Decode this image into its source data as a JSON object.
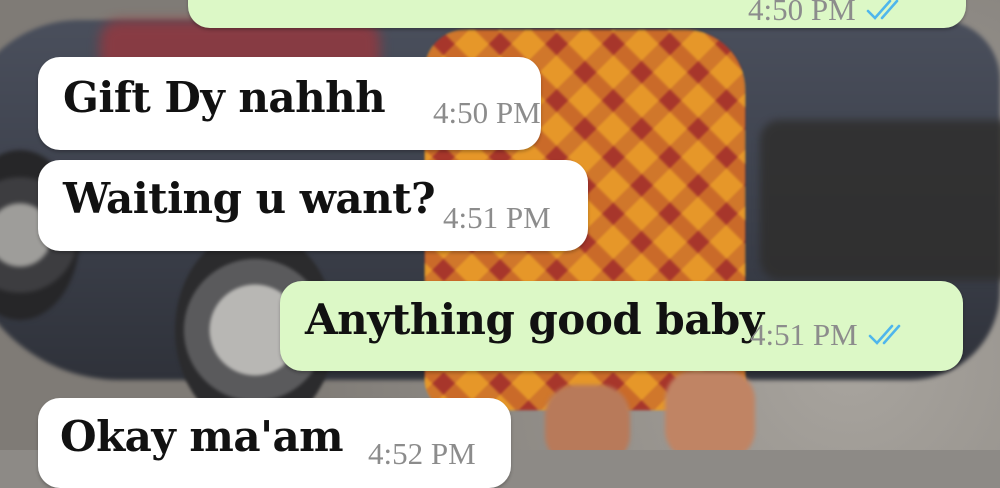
{
  "chat": {
    "messages": [
      {
        "direction": "outgoing",
        "text": "",
        "time": "4:50 PM",
        "status": "read"
      },
      {
        "direction": "incoming",
        "text": "Gift Dy nahhh",
        "time": "4:50 PM"
      },
      {
        "direction": "incoming",
        "text": "Waiting u want?",
        "time": "4:51 PM"
      },
      {
        "direction": "outgoing",
        "text": "Anything good baby",
        "time": "4:51 PM",
        "status": "read"
      },
      {
        "direction": "incoming",
        "text": "Okay ma'am",
        "time": "4:52 PM"
      }
    ]
  },
  "colors": {
    "incoming_bubble": "#ffffff",
    "outgoing_bubble": "#dcf8c6",
    "timestamp": "#8c8c8c",
    "read_ticks": "#4fb6ec"
  },
  "icons": {
    "read_status": "double-check-icon"
  }
}
